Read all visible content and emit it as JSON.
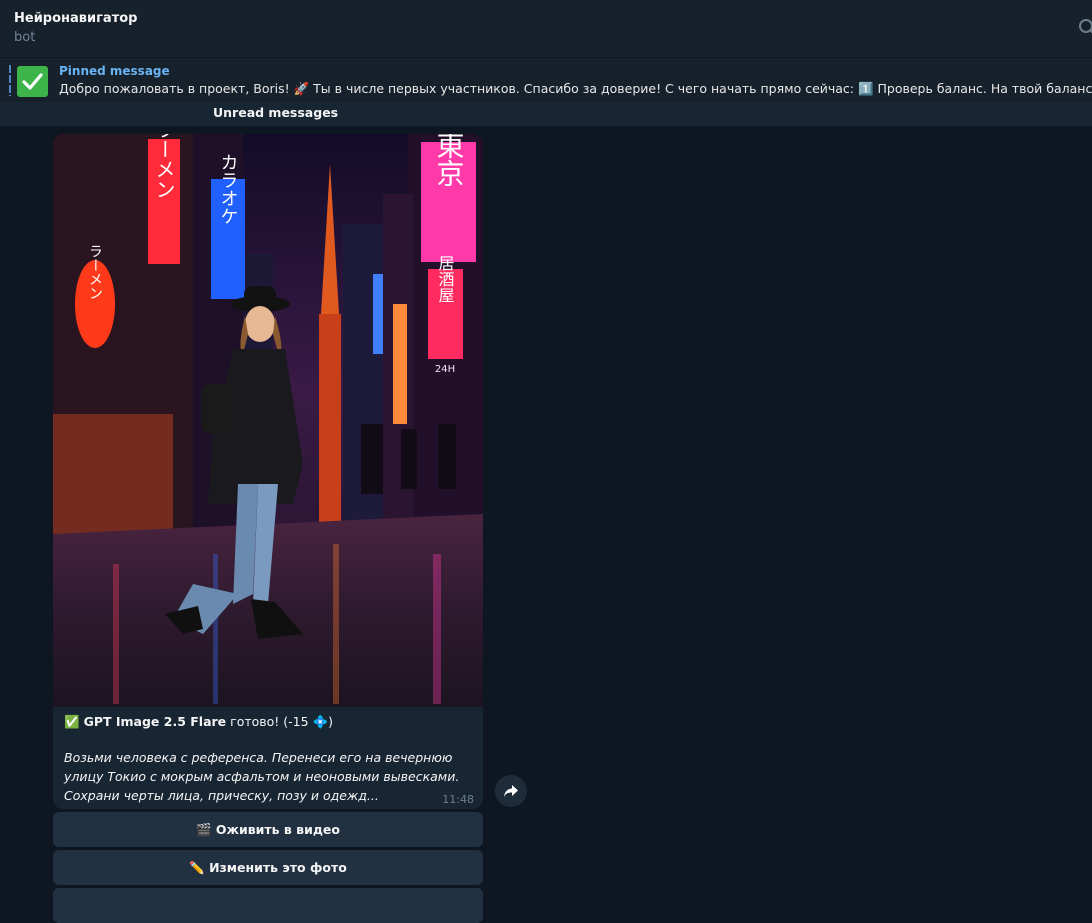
{
  "header": {
    "title": "Нейронавигатор",
    "subtitle": "bot"
  },
  "pinned": {
    "label": "Pinned message",
    "text": "Добро пожаловать в проект, Boris! 🚀  Ты в числе первых участников. Спасибо за доверие!  С чего начать прямо сейчас:  1️⃣ Проверь баланс. На твой баланс в боте у"
  },
  "unread": {
    "label": "Unread messages"
  },
  "message": {
    "status_emoji": "✅",
    "model": "GPT Image 2.5 Flare",
    "status_text": " готово! (-15 💠)",
    "prompt": "Возьми человека с референса. Перенеси его на вечернюю улицу Токио с мокрым асфальтом и неоновыми вывесками. Сохрани черты лица, прическу, позу и одежд...",
    "time": "11:48"
  },
  "buttons": {
    "animate": "🎬 Оживить в видео",
    "edit": "✏️ Изменить это фото"
  },
  "photo_signs": {
    "ramen_top": "ラーメン",
    "karaoke": "カラオケ",
    "tokyo": "東京",
    "izakaya": "居酒屋",
    "ramen_lantern": "ラーメン",
    "open24": "24H"
  },
  "colors": {
    "bg": "#0e1621",
    "panel": "#17212b",
    "accent": "#6ab3f3",
    "check": "#3cb44a"
  }
}
